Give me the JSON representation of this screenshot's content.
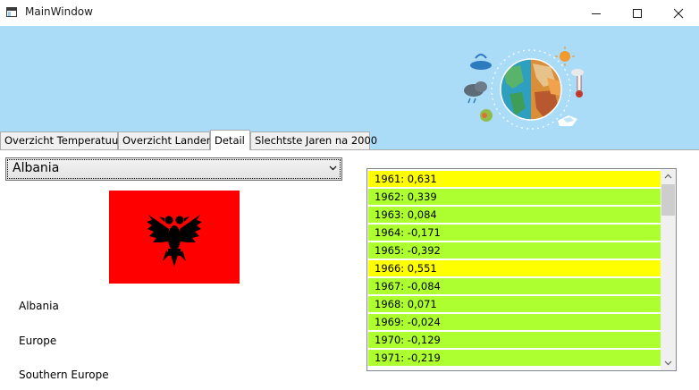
{
  "window": {
    "title": "MainWindow"
  },
  "tabs": [
    {
      "label": "Overzicht Temperatuur",
      "active": false
    },
    {
      "label": "Overzicht Landen",
      "active": false
    },
    {
      "label": "Detail",
      "active": true
    },
    {
      "label": "Slechtste Jaren na 2000",
      "active": false
    }
  ],
  "detail": {
    "country_select": {
      "selected": "Albania"
    },
    "country_name": "Albania",
    "region": "Europe",
    "subregion": "Southern Europe"
  },
  "anomalies": {
    "items": [
      {
        "label": "1961: 0,631",
        "status": "warm"
      },
      {
        "label": "1962: 0,339",
        "status": "normal"
      },
      {
        "label": "1963: 0,084",
        "status": "normal"
      },
      {
        "label": "1964: -0,171",
        "status": "normal"
      },
      {
        "label": "1965: -0,392",
        "status": "normal"
      },
      {
        "label": "1966: 0,551",
        "status": "warm"
      },
      {
        "label": "1967: -0,084",
        "status": "normal"
      },
      {
        "label": "1968: 0,071",
        "status": "normal"
      },
      {
        "label": "1969: -0,024",
        "status": "normal"
      },
      {
        "label": "1970: -0,129",
        "status": "normal"
      },
      {
        "label": "1971: -0,219",
        "status": "normal"
      }
    ]
  },
  "colors": {
    "header_background": "#abdcf7",
    "row_warm": "#ffff00",
    "row_normal": "#adff2f",
    "flag_red": "#ff0000"
  },
  "icons": {
    "app": "window-app-icon",
    "minimize": "minimize-icon",
    "maximize": "maximize-icon",
    "close": "close-icon",
    "combo": "chevron-down-icon",
    "scroll_up": "chevron-up-icon",
    "scroll_down": "chevron-down-icon"
  }
}
